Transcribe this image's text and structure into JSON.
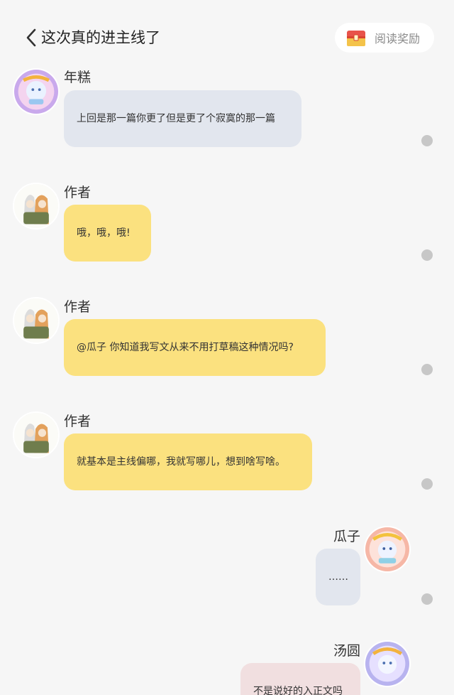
{
  "header": {
    "back_icon": "chevron-left-icon",
    "title": "这次真的进主线了",
    "reward": {
      "icon": "treasure-chest-icon",
      "label": "阅读奖励"
    }
  },
  "messages": [
    {
      "side": "left",
      "name": "年糕",
      "text": "上回是那一篇你更了但是更了个寂寞的那一篇",
      "bubble_color": "#e2e6ee"
    },
    {
      "side": "left",
      "name": "作者",
      "text": "哦，哦，哦!",
      "bubble_color": "#fbe17f"
    },
    {
      "side": "left",
      "name": "作者",
      "text": "@瓜子 你知道我写文从来不用打草稿这种情况吗?",
      "bubble_color": "#fbe17f"
    },
    {
      "side": "left",
      "name": "作者",
      "text": "就基本是主线偏哪，我就写哪儿，想到啥写啥。",
      "bubble_color": "#fbe17f"
    },
    {
      "side": "right",
      "name": "瓜子",
      "text": "……",
      "bubble_color": "#e2e6ee"
    },
    {
      "side": "right",
      "name": "汤圆",
      "text": "不是说好的入正文吗",
      "bubble_color": "#f1dfe0"
    }
  ],
  "colors": {
    "background": "#f6f6f6",
    "reward_chest": "#e8534a",
    "status_dot": "#c7c7c7"
  }
}
